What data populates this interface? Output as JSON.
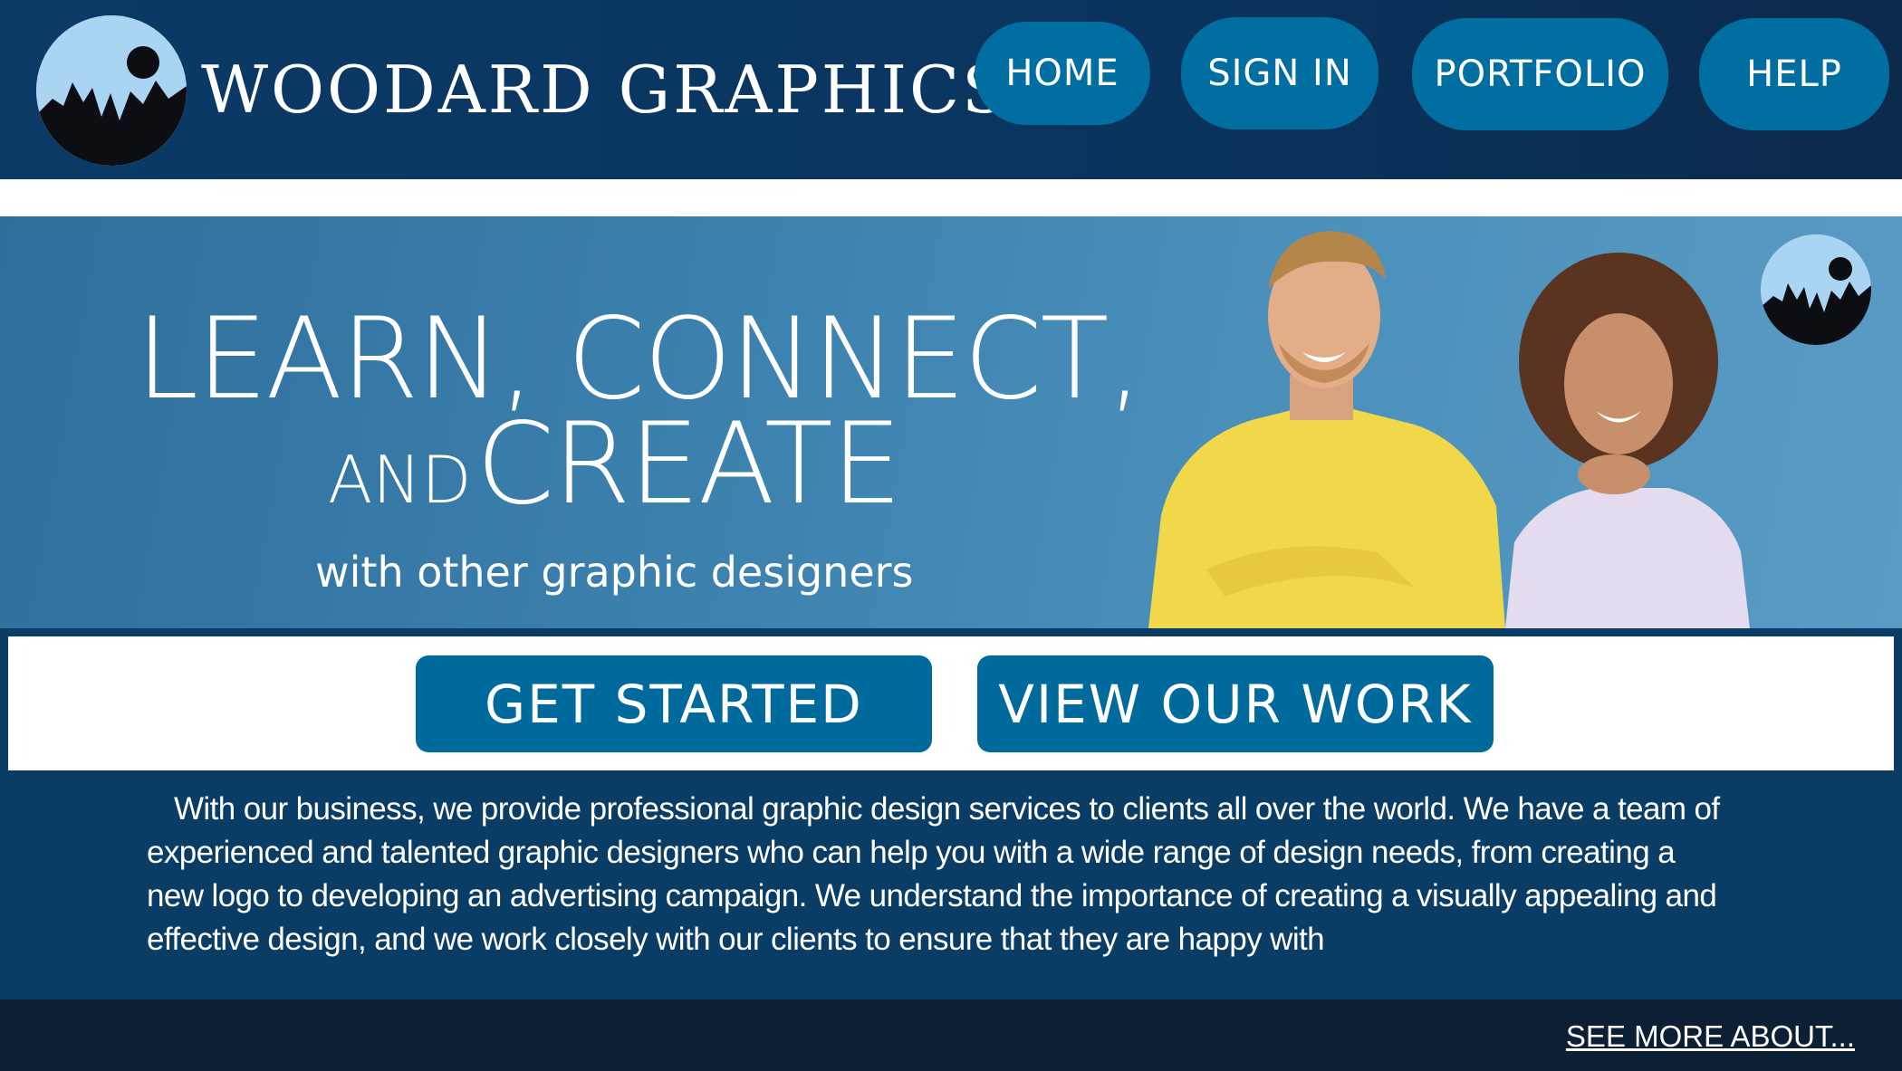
{
  "header": {
    "logo_icon": "brand-logo-icon",
    "brand_name": "WOODARD GRAPHICS",
    "nav": [
      {
        "label": "HOME"
      },
      {
        "label": "SIGN  IN"
      },
      {
        "label": "PORTFOLIO"
      },
      {
        "label": "HELP"
      }
    ]
  },
  "hero": {
    "line1": "LEARN, CONNECT,",
    "line2_small": "AND",
    "line2_big": "CREATE",
    "subtitle": "with other graphic designers",
    "photo": "smiling-designers-photo"
  },
  "cta": {
    "get_started": "GET  STARTED",
    "view_work": "VIEW  OUR  WORK"
  },
  "description": "With our business, we provide professional graphic design services to clients all over the world.  We have a team of experienced and talented graphic designers who can help you with a wide range of design needs, from creating a new logo to developing an advertising campaign.  We understand the importance of creating a visually appealing and effective design, and we work closely with our clients to ensure that they are happy with",
  "footer": {
    "see_more": "SEE MORE ABOUT..."
  },
  "colors": {
    "header_bg": "#0b3a66",
    "button_blue": "#006ea0",
    "hero_bg": "#3b7fad",
    "logo_sky": "#a9d4f2",
    "footer_bg": "#0d1f35"
  }
}
